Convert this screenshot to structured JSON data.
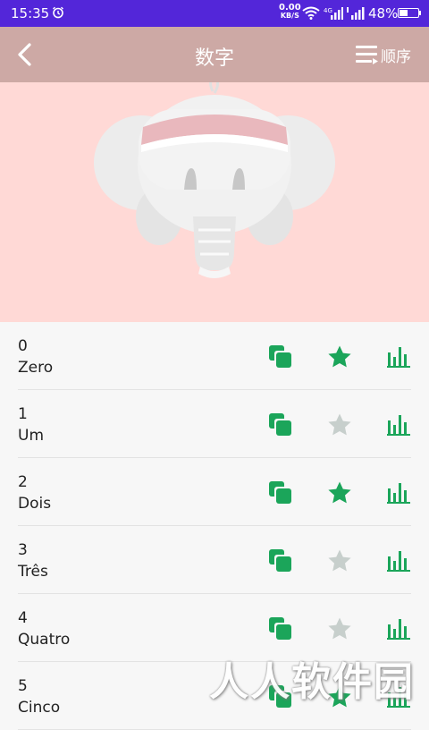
{
  "status_bar": {
    "time": "15:35",
    "net_speed_value": "0.00",
    "net_speed_unit": "KB/S",
    "network": "4G",
    "battery_text": "48%",
    "battery_level": 0.48
  },
  "app_bar": {
    "title": "数字",
    "order_label": "顺序"
  },
  "colors": {
    "status_bar": "#5326d9",
    "app_bar": "#cda9a5",
    "hero": "#ffd9d6",
    "accent_green": "#1ba55a",
    "star_inactive": "#c7cfcc"
  },
  "items": [
    {
      "number": "0",
      "word": "Zero",
      "favorite": true
    },
    {
      "number": "1",
      "word": "Um",
      "favorite": false
    },
    {
      "number": "2",
      "word": "Dois",
      "favorite": true
    },
    {
      "number": "3",
      "word": "Três",
      "favorite": false
    },
    {
      "number": "4",
      "word": "Quatro",
      "favorite": false
    },
    {
      "number": "5",
      "word": "Cinco",
      "favorite": true
    }
  ],
  "watermark": "人人软件园"
}
